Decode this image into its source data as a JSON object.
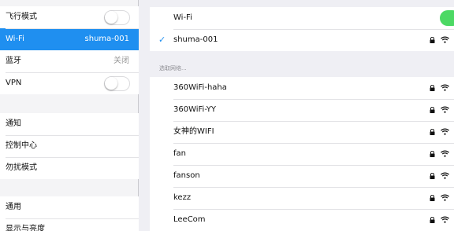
{
  "sidebar": {
    "group1": [
      {
        "label": "飞行模式",
        "type": "toggle"
      },
      {
        "label": "Wi-Fi",
        "value": "shuma-001",
        "selected": true
      },
      {
        "label": "蓝牙",
        "value": "关闭"
      },
      {
        "label": "VPN",
        "type": "toggle"
      }
    ],
    "group2": [
      {
        "label": "通知"
      },
      {
        "label": "控制中心"
      },
      {
        "label": "勿扰模式"
      }
    ],
    "group3": [
      {
        "label": "通用"
      },
      {
        "label": "显示与亮度"
      }
    ]
  },
  "wifi": {
    "header_label": "Wi-Fi",
    "connected_network": "shuma-001",
    "choose_network_label": "选取网络...",
    "networks": [
      {
        "name": "360WiFi-haha"
      },
      {
        "name": "360WiFi-YY"
      },
      {
        "name": "女神的WIFI"
      },
      {
        "name": "fan"
      },
      {
        "name": "fanson"
      },
      {
        "name": "kezz"
      },
      {
        "name": "LeeCom"
      }
    ]
  },
  "colors": {
    "accent": "#1f8ff0",
    "toggle_on": "#4cd964",
    "background": "#efeff4"
  },
  "icons": [
    "checkmark-icon",
    "lock-icon",
    "wifi-signal-icon",
    "toggle-switch"
  ]
}
